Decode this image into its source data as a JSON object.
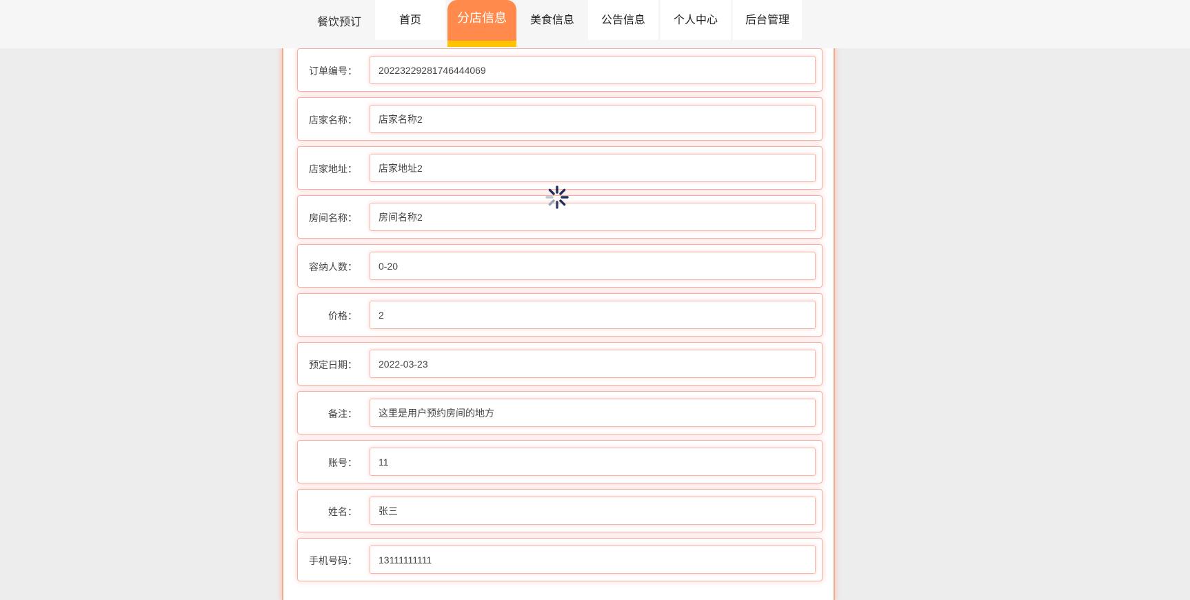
{
  "header": {
    "brand": "餐饮预订",
    "nav": [
      {
        "label": "首页"
      },
      {
        "label": "分店信息"
      },
      {
        "label": "美食信息"
      },
      {
        "label": "公告信息"
      },
      {
        "label": "个人中心"
      },
      {
        "label": "后台管理"
      }
    ],
    "active_nav": "分店信息"
  },
  "form": {
    "fields": [
      {
        "label": "订单编号：",
        "value": "20223229281746444069"
      },
      {
        "label": "店家名称：",
        "value": "店家名称2"
      },
      {
        "label": "店家地址：",
        "value": "店家地址2"
      },
      {
        "label": "房间名称：",
        "value": "房间名称2"
      },
      {
        "label": "容纳人数：",
        "value": "0-20"
      },
      {
        "label": "价格：",
        "value": "2"
      },
      {
        "label": "预定日期：",
        "value": "2022-03-23"
      },
      {
        "label": "备注：",
        "value": "这里是用户预约房间的地方"
      },
      {
        "label": "账号：",
        "value": "11"
      },
      {
        "label": "姓名：",
        "value": "张三"
      },
      {
        "label": "手机号码：",
        "value": "13111111111"
      }
    ]
  },
  "loading": {
    "icon": "spinner-icon"
  },
  "colors": {
    "accent": "#ff8a4c",
    "accent_bar": "#ffc300",
    "field_border": "#f5b0a0",
    "page_bg": "#ededed"
  }
}
